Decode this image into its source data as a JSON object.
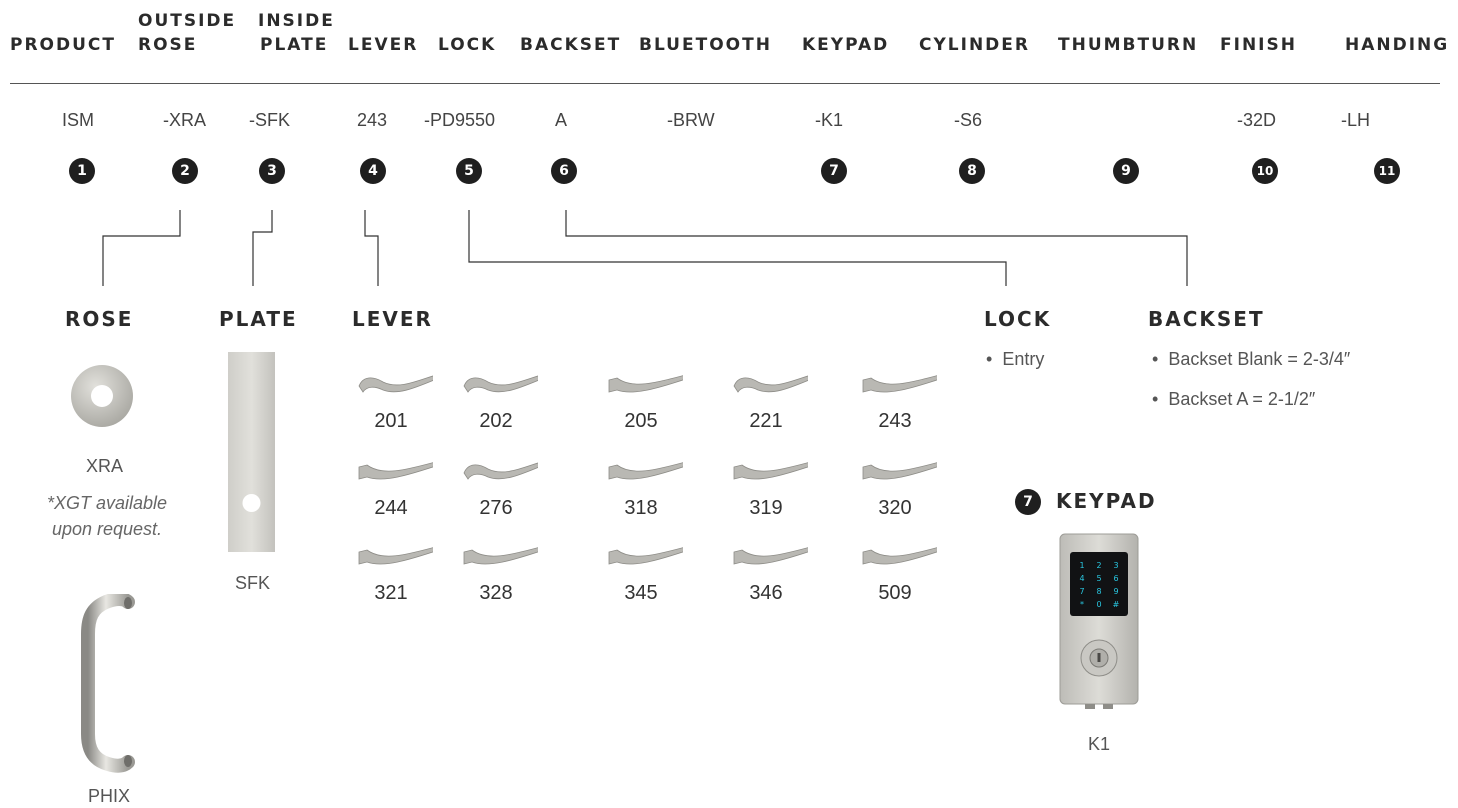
{
  "headers": {
    "product": [
      "PRODUCT"
    ],
    "outside_rose": [
      "OUTSIDE",
      "ROSE"
    ],
    "inside_plate": [
      "INSIDE",
      "PLATE"
    ],
    "lever": [
      "LEVER"
    ],
    "lock": [
      "LOCK"
    ],
    "backset": [
      "BACKSET"
    ],
    "bluetooth": [
      "BLUETOOTH"
    ],
    "keypad": [
      "KEYPAD"
    ],
    "cylinder": [
      "CYLINDER"
    ],
    "thumbturn": [
      "THUMBTURN"
    ],
    "finish": [
      "FINISH"
    ],
    "handing": [
      "HANDING"
    ]
  },
  "codes": {
    "product": "ISM",
    "rose": "-XRA",
    "plate": "-SFK",
    "lever": "243",
    "lock": "-PD9550",
    "backset": "A",
    "bluetooth": "-BRW",
    "keypad": "-K1",
    "cylinder": "-S6",
    "finish": "-32D",
    "handing": "-LH"
  },
  "markers": [
    "1",
    "2",
    "3",
    "4",
    "5",
    "6",
    "7",
    "8",
    "9",
    "10",
    "11"
  ],
  "sections": {
    "rose": {
      "title": "ROSE",
      "image_label": "XRA",
      "note_line1": "*XGT available",
      "note_line2": "upon request.",
      "pull_label": "PHIX"
    },
    "plate": {
      "title": "PLATE",
      "image_label": "SFK"
    },
    "lever": {
      "title": "LEVER",
      "options": [
        "201",
        "202",
        "205",
        "221",
        "243",
        "244",
        "276",
        "318",
        "319",
        "320",
        "321",
        "328",
        "345",
        "346",
        "509"
      ]
    },
    "lock": {
      "title": "LOCK",
      "bullets": [
        "Entry"
      ]
    },
    "backset": {
      "title": "BACKSET",
      "bullets": [
        "Backset Blank = 2-3/4″",
        "Backset A = 2-1/2″"
      ]
    },
    "keypad": {
      "marker": "7",
      "title": "KEYPAD",
      "image_label": "K1",
      "keys": [
        "1",
        "2",
        "3",
        "4",
        "5",
        "6",
        "7",
        "8",
        "9",
        "*",
        "0",
        "#"
      ]
    }
  },
  "colors": {
    "marker_bg": "#1f1f1f",
    "text": "#2b2b2b",
    "metal": "#c9c8c3",
    "keypad_glow": "#29c6e0"
  }
}
